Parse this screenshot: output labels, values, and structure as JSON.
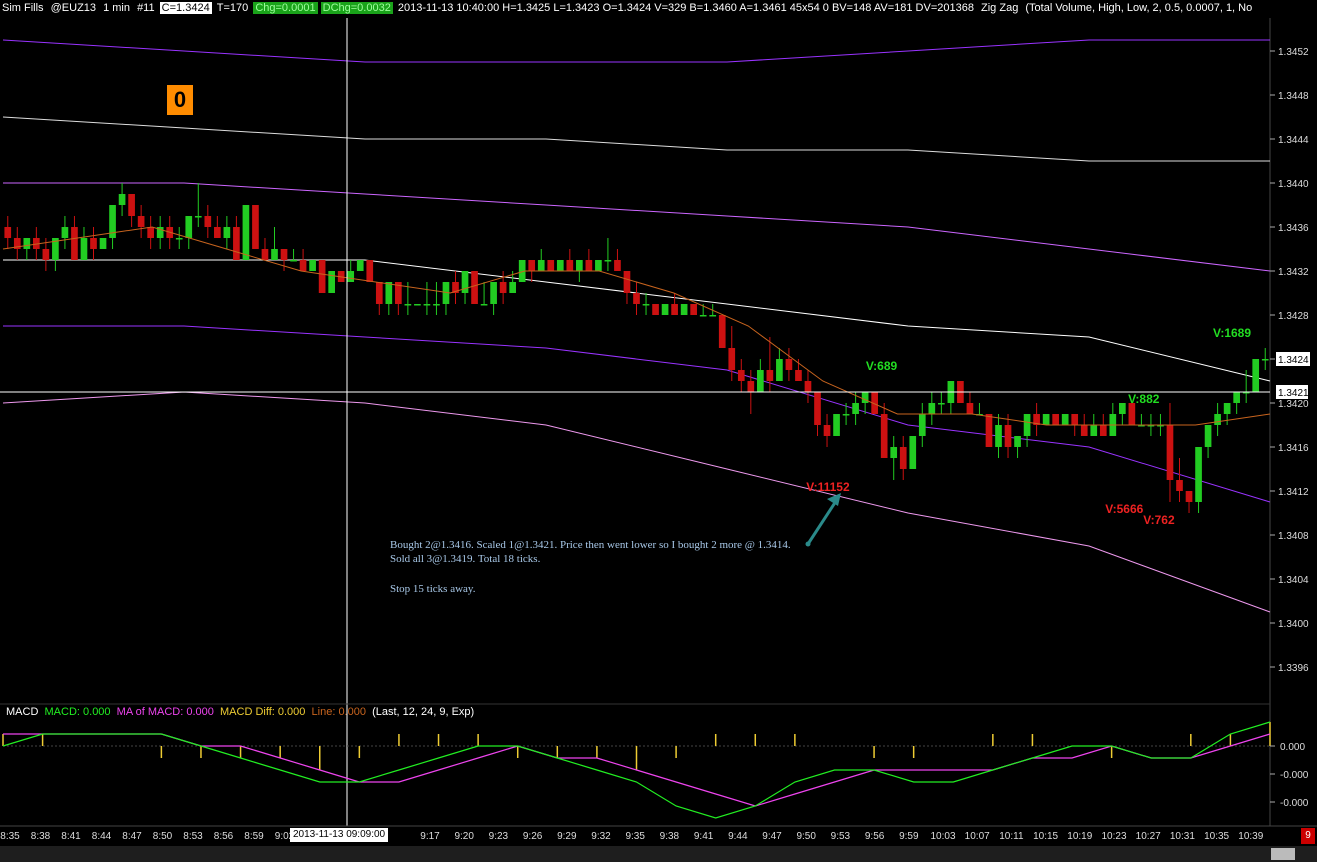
{
  "header": {
    "title": "Sim Fills",
    "symbol": "@EUZ13",
    "interval": "1 min",
    "bar_no": "#11",
    "close": "C=1.3424",
    "ticks": "T=170",
    "chg": "Chg=0.0001",
    "dchg": "DChg=0.0032",
    "stats": "2013-11-13 10:40:00 H=1.3425 L=1.3423 O=1.3424 V=329 B=1.3460 A=1.3461 45x54 0 BV=148 AV=181 DV=201368",
    "study": "Zig Zag",
    "study_params": "(Total Volume, High, Low, 2, 0.5, 0.0007, 1, No"
  },
  "badge": "0",
  "note": {
    "line1": "Bought 2@1.3416. Scaled 1@1.3421. Price then went lower so I bought 2 more @ 1.3414. Sold all 3@1.3419. Total 18 ticks.",
    "line2": "Stop 15 ticks away."
  },
  "macd_legend": {
    "name": "MACD",
    "macd": "MACD: 0.000",
    "ma": "MA of MACD: 0.000",
    "diff": "MACD Diff: 0.000",
    "line": "Line: 0.000",
    "params": "(Last, 12, 24, 9, Exp)"
  },
  "crosshair_time": "2013-11-13  09:09:00",
  "corner_badge": "9",
  "colors": {
    "up": "#22cc22",
    "down": "#cc1111",
    "bg": "#000000",
    "purple": "#9933ff",
    "violet": "#cc66ff",
    "orchid": "#ee99ee",
    "white_band": "#dddddd",
    "ma": "#c8641e"
  },
  "chart_data": [
    {
      "type": "candlestick",
      "price_axis": {
        "ticks": [
          "1.3452",
          "1.3448",
          "1.3444",
          "1.3440",
          "1.3436",
          "1.3432",
          "1.3428",
          "1.3424",
          "1.3420",
          "1.3416",
          "1.3412",
          "1.3408",
          "1.3404",
          "1.3400",
          "1.3396"
        ],
        "last_price": "1.3424",
        "crosshair_price": "1.3421",
        "ylim": [
          1.3393,
          1.3455
        ]
      },
      "x_ticks": [
        "8:35",
        "8:38",
        "8:41",
        "8:44",
        "8:47",
        "8:50",
        "8:53",
        "8:56",
        "8:59",
        "9:02",
        "9:17",
        "9:20",
        "9:23",
        "9:26",
        "9:29",
        "9:32",
        "9:35",
        "9:38",
        "9:41",
        "9:44",
        "9:47",
        "9:50",
        "9:53",
        "9:56",
        "9:59",
        "10:03",
        "10:07",
        "10:11",
        "10:15",
        "10:19",
        "10:23",
        "10:27",
        "10:31",
        "10:35",
        "10:39"
      ],
      "candles": [
        [
          1.3436,
          1.3437,
          1.3434,
          1.3435
        ],
        [
          1.3435,
          1.3436,
          1.3433,
          1.3434
        ],
        [
          1.3434,
          1.3435,
          1.3433,
          1.3435
        ],
        [
          1.3435,
          1.3436,
          1.3433,
          1.3434
        ],
        [
          1.3434,
          1.3435,
          1.3432,
          1.3433
        ],
        [
          1.3433,
          1.3435,
          1.3432,
          1.3435
        ],
        [
          1.3435,
          1.3437,
          1.3434,
          1.3436
        ],
        [
          1.3436,
          1.3437,
          1.3433,
          1.3433
        ],
        [
          1.3433,
          1.3436,
          1.3433,
          1.3435
        ],
        [
          1.3435,
          1.3436,
          1.3433,
          1.3434
        ],
        [
          1.3434,
          1.3435,
          1.3434,
          1.3435
        ],
        [
          1.3435,
          1.3438,
          1.3434,
          1.3438
        ],
        [
          1.3438,
          1.344,
          1.3437,
          1.3439
        ],
        [
          1.3439,
          1.3439,
          1.3436,
          1.3437
        ],
        [
          1.3437,
          1.3438,
          1.3435,
          1.3436
        ],
        [
          1.3436,
          1.3437,
          1.3434,
          1.3435
        ],
        [
          1.3435,
          1.3437,
          1.3434,
          1.3436
        ],
        [
          1.3436,
          1.3437,
          1.3434,
          1.3435
        ],
        [
          1.3435,
          1.3436,
          1.3434,
          1.3435
        ],
        [
          1.3435,
          1.3437,
          1.3434,
          1.3437
        ],
        [
          1.3437,
          1.344,
          1.3436,
          1.3437
        ],
        [
          1.3437,
          1.3438,
          1.3435,
          1.3436
        ],
        [
          1.3436,
          1.3437,
          1.3435,
          1.3435
        ],
        [
          1.3435,
          1.3437,
          1.3434,
          1.3436
        ],
        [
          1.3436,
          1.3437,
          1.3433,
          1.3433
        ],
        [
          1.3433,
          1.3438,
          1.3433,
          1.3438
        ],
        [
          1.3438,
          1.3438,
          1.3434,
          1.3434
        ],
        [
          1.3434,
          1.3435,
          1.3433,
          1.3433
        ],
        [
          1.3433,
          1.3436,
          1.3433,
          1.3434
        ],
        [
          1.3434,
          1.3434,
          1.3432,
          1.3433
        ],
        [
          1.3433,
          1.3434,
          1.3433,
          1.3433
        ],
        [
          1.3433,
          1.3434,
          1.3432,
          1.3432
        ],
        [
          1.3432,
          1.3433,
          1.3432,
          1.3433
        ],
        [
          1.3433,
          1.3433,
          1.343,
          1.343
        ],
        [
          1.343,
          1.3432,
          1.343,
          1.3432
        ],
        [
          1.3432,
          1.3432,
          1.3431,
          1.3431
        ],
        [
          1.3431,
          1.3433,
          1.3431,
          1.3432
        ],
        [
          1.3432,
          1.3433,
          1.3432,
          1.3433
        ],
        [
          1.3433,
          1.3433,
          1.3431,
          1.3431
        ],
        [
          1.3431,
          1.3431,
          1.3428,
          1.3429
        ],
        [
          1.3429,
          1.3431,
          1.3428,
          1.3431
        ],
        [
          1.3431,
          1.3431,
          1.3428,
          1.3429
        ],
        [
          1.3429,
          1.3431,
          1.3428,
          1.3429
        ],
        [
          1.3429,
          1.3429,
          1.3429,
          1.3429
        ],
        [
          1.3429,
          1.3431,
          1.3428,
          1.3429
        ],
        [
          1.3429,
          1.3431,
          1.3428,
          1.3429
        ],
        [
          1.3429,
          1.3431,
          1.3428,
          1.3431
        ],
        [
          1.3431,
          1.3432,
          1.3429,
          1.343
        ],
        [
          1.343,
          1.3432,
          1.3429,
          1.3432
        ],
        [
          1.3432,
          1.3432,
          1.3429,
          1.3429
        ],
        [
          1.3429,
          1.3431,
          1.3429,
          1.3429
        ],
        [
          1.3429,
          1.3431,
          1.3428,
          1.3431
        ],
        [
          1.3431,
          1.3432,
          1.3429,
          1.343
        ],
        [
          1.343,
          1.3432,
          1.343,
          1.3431
        ],
        [
          1.3431,
          1.3433,
          1.3431,
          1.3433
        ],
        [
          1.3433,
          1.3433,
          1.3431,
          1.3432
        ],
        [
          1.3432,
          1.3434,
          1.3432,
          1.3433
        ],
        [
          1.3433,
          1.3433,
          1.3432,
          1.3432
        ],
        [
          1.3432,
          1.3433,
          1.3432,
          1.3433
        ],
        [
          1.3433,
          1.3434,
          1.3432,
          1.3432
        ],
        [
          1.3432,
          1.3433,
          1.3431,
          1.3433
        ],
        [
          1.3433,
          1.3434,
          1.3432,
          1.3432
        ],
        [
          1.3432,
          1.3433,
          1.3432,
          1.3433
        ],
        [
          1.3433,
          1.3435,
          1.3432,
          1.3433
        ],
        [
          1.3433,
          1.3434,
          1.3432,
          1.3432
        ],
        [
          1.3432,
          1.3432,
          1.3429,
          1.343
        ],
        [
          1.343,
          1.3431,
          1.3428,
          1.3429
        ],
        [
          1.3429,
          1.343,
          1.3428,
          1.3429
        ],
        [
          1.3429,
          1.3429,
          1.3428,
          1.3428
        ],
        [
          1.3428,
          1.3429,
          1.3428,
          1.3429
        ],
        [
          1.3429,
          1.343,
          1.3428,
          1.3428
        ],
        [
          1.3428,
          1.3429,
          1.3428,
          1.3429
        ],
        [
          1.3429,
          1.3429,
          1.3428,
          1.3428
        ],
        [
          1.3428,
          1.3429,
          1.3428,
          1.3428
        ],
        [
          1.3428,
          1.3429,
          1.3428,
          1.3428
        ],
        [
          1.3428,
          1.3428,
          1.3425,
          1.3425
        ],
        [
          1.3425,
          1.3427,
          1.3422,
          1.3423
        ],
        [
          1.3423,
          1.3424,
          1.3421,
          1.3422
        ],
        [
          1.3422,
          1.3423,
          1.3419,
          1.3421
        ],
        [
          1.3421,
          1.3424,
          1.3421,
          1.3423
        ],
        [
          1.3423,
          1.3426,
          1.3421,
          1.3422
        ],
        [
          1.3422,
          1.3425,
          1.3422,
          1.3424
        ],
        [
          1.3424,
          1.3425,
          1.3422,
          1.3423
        ],
        [
          1.3423,
          1.3424,
          1.3422,
          1.3422
        ],
        [
          1.3422,
          1.3423,
          1.342,
          1.3421
        ],
        [
          1.3421,
          1.3421,
          1.3417,
          1.3418
        ],
        [
          1.3418,
          1.3419,
          1.3416,
          1.3417
        ],
        [
          1.3417,
          1.3419,
          1.3417,
          1.3419
        ],
        [
          1.3419,
          1.342,
          1.3418,
          1.3419
        ],
        [
          1.3419,
          1.3421,
          1.3418,
          1.342
        ],
        [
          1.342,
          1.3421,
          1.3419,
          1.3421
        ],
        [
          1.3421,
          1.3421,
          1.3419,
          1.3419
        ],
        [
          1.3419,
          1.342,
          1.3415,
          1.3415
        ],
        [
          1.3415,
          1.3417,
          1.3413,
          1.3416
        ],
        [
          1.3416,
          1.3417,
          1.3413,
          1.3414
        ],
        [
          1.3414,
          1.3417,
          1.3414,
          1.3417
        ],
        [
          1.3417,
          1.342,
          1.3416,
          1.3419
        ],
        [
          1.3419,
          1.3421,
          1.3418,
          1.342
        ],
        [
          1.342,
          1.3421,
          1.3419,
          1.342
        ],
        [
          1.342,
          1.3422,
          1.3419,
          1.3422
        ],
        [
          1.3422,
          1.3422,
          1.342,
          1.342
        ],
        [
          1.342,
          1.3421,
          1.3419,
          1.3419
        ],
        [
          1.3419,
          1.342,
          1.3419,
          1.3419
        ],
        [
          1.3419,
          1.3419,
          1.3416,
          1.3416
        ],
        [
          1.3416,
          1.3419,
          1.3415,
          1.3418
        ],
        [
          1.3418,
          1.3419,
          1.3415,
          1.3416
        ],
        [
          1.3416,
          1.3417,
          1.3415,
          1.3417
        ],
        [
          1.3417,
          1.3419,
          1.3416,
          1.3419
        ],
        [
          1.3419,
          1.342,
          1.3417,
          1.3418
        ],
        [
          1.3418,
          1.3419,
          1.3418,
          1.3419
        ],
        [
          1.3419,
          1.3419,
          1.3418,
          1.3418
        ],
        [
          1.3418,
          1.3419,
          1.3418,
          1.3419
        ],
        [
          1.3419,
          1.3419,
          1.3417,
          1.3418
        ],
        [
          1.3418,
          1.3419,
          1.3417,
          1.3417
        ],
        [
          1.3417,
          1.3419,
          1.3417,
          1.3418
        ],
        [
          1.3418,
          1.3419,
          1.3417,
          1.3417
        ],
        [
          1.3417,
          1.342,
          1.3417,
          1.3419
        ],
        [
          1.3419,
          1.342,
          1.3418,
          1.342
        ],
        [
          1.342,
          1.342,
          1.3418,
          1.3418
        ],
        [
          1.3418,
          1.3419,
          1.3418,
          1.3418
        ],
        [
          1.3418,
          1.3419,
          1.3417,
          1.3418
        ],
        [
          1.3418,
          1.3419,
          1.3417,
          1.3418
        ],
        [
          1.3418,
          1.342,
          1.3411,
          1.3413
        ],
        [
          1.3413,
          1.3415,
          1.3411,
          1.3412
        ],
        [
          1.3412,
          1.3412,
          1.341,
          1.3411
        ],
        [
          1.3411,
          1.3416,
          1.341,
          1.3416
        ],
        [
          1.3416,
          1.3418,
          1.3415,
          1.3418
        ],
        [
          1.3418,
          1.342,
          1.3417,
          1.3419
        ],
        [
          1.3419,
          1.342,
          1.3418,
          1.342
        ],
        [
          1.342,
          1.3421,
          1.3419,
          1.3421
        ],
        [
          1.3421,
          1.3423,
          1.342,
          1.3421
        ],
        [
          1.3421,
          1.3424,
          1.3421,
          1.3424
        ],
        [
          1.3424,
          1.3425,
          1.3423,
          1.3424
        ]
      ],
      "lines": [
        {
          "color": "#9933ff",
          "values": [
            1.3453,
            1.3452,
            1.3451,
            1.3451,
            1.3451,
            1.3452,
            1.3453,
            1.3453
          ]
        },
        {
          "color": "#dddddd",
          "values": [
            1.3446,
            1.3445,
            1.3444,
            1.3444,
            1.3443,
            1.3443,
            1.3442,
            1.3442
          ]
        },
        {
          "color": "#cc66ff",
          "values": [
            1.344,
            1.344,
            1.3439,
            1.3438,
            1.3437,
            1.3436,
            1.3434,
            1.3432
          ]
        },
        {
          "color": "#ffffff",
          "values": [
            1.3433,
            1.3433,
            1.3433,
            1.3431,
            1.3429,
            1.3427,
            1.3426,
            1.3422
          ]
        },
        {
          "color": "#9933ff",
          "values": [
            1.3427,
            1.3427,
            1.3426,
            1.3425,
            1.3423,
            1.3418,
            1.3416,
            1.3411
          ]
        },
        {
          "color": "#ee99ee",
          "values": [
            1.342,
            1.3421,
            1.342,
            1.3418,
            1.3414,
            1.341,
            1.3407,
            1.3401
          ]
        }
      ],
      "ma_values": [
        1.3434,
        1.3435,
        1.3436,
        1.3434,
        1.3432,
        1.3431,
        1.343,
        1.3432,
        1.3432,
        1.343,
        1.3427,
        1.3422,
        1.3419,
        1.3419,
        1.3418,
        1.3418,
        1.3418,
        1.3419
      ],
      "labels": [
        {
          "text": "V:689",
          "color": "#22dd22",
          "x": 0.681,
          "y": 1.3423
        },
        {
          "text": "V:882",
          "color": "#22dd22",
          "x": 0.888,
          "y": 1.342
        },
        {
          "text": "V:1689",
          "color": "#22dd22",
          "x": 0.955,
          "y": 1.3426
        },
        {
          "text": "V:11152",
          "color": "#ee2222",
          "x": 0.634,
          "y": 1.3412
        },
        {
          "text": "V:5666",
          "color": "#ee2222",
          "x": 0.87,
          "y": 1.341
        },
        {
          "text": "V:762",
          "color": "#ee2222",
          "x": 0.9,
          "y": 1.3409
        }
      ]
    },
    {
      "type": "line",
      "title": "MACD",
      "y_ticks": [
        "0.000",
        "-0.000",
        "-0.000"
      ],
      "macd": [
        0.0,
        0.0001,
        0.0001,
        0.0001,
        0.0001,
        0.0,
        -0.0001,
        -0.0002,
        -0.0003,
        -0.0003,
        -0.0002,
        -0.0001,
        0.0,
        0.0,
        -0.0001,
        -0.0002,
        -0.0003,
        -0.0005,
        -0.0006,
        -0.0005,
        -0.0003,
        -0.0002,
        -0.0002,
        -0.0003,
        -0.0003,
        -0.0002,
        -0.0001,
        0.0,
        0.0,
        -0.0001,
        -0.0001,
        0.0001,
        0.0002
      ],
      "ma": [
        0.0001,
        0.0001,
        0.0001,
        0.0001,
        0.0001,
        0.0,
        0.0,
        -0.0001,
        -0.0002,
        -0.0003,
        -0.0003,
        -0.0002,
        -0.0001,
        0.0,
        -0.0001,
        -0.0001,
        -0.0002,
        -0.0003,
        -0.0004,
        -0.0005,
        -0.0004,
        -0.0003,
        -0.0002,
        -0.0002,
        -0.0002,
        -0.0002,
        -0.0001,
        -0.0001,
        0.0,
        -0.0001,
        -0.0001,
        0.0,
        0.0001
      ],
      "diff": [
        0.0001,
        0.0001,
        0.0,
        0.0,
        -0.0001,
        -0.0001,
        -0.0001,
        -0.0001,
        -0.0002,
        -0.0001,
        0.0001,
        0.0001,
        0.0001,
        -0.0001,
        -0.0001,
        -0.0001,
        -0.0002,
        -0.0001,
        0.0001,
        0.0001,
        0.0001,
        0.0,
        -0.0001,
        -0.0001,
        0.0,
        0.0001,
        0.0001,
        0.0,
        -0.0001,
        0.0,
        0.0001,
        0.0001,
        0.0002
      ]
    }
  ]
}
